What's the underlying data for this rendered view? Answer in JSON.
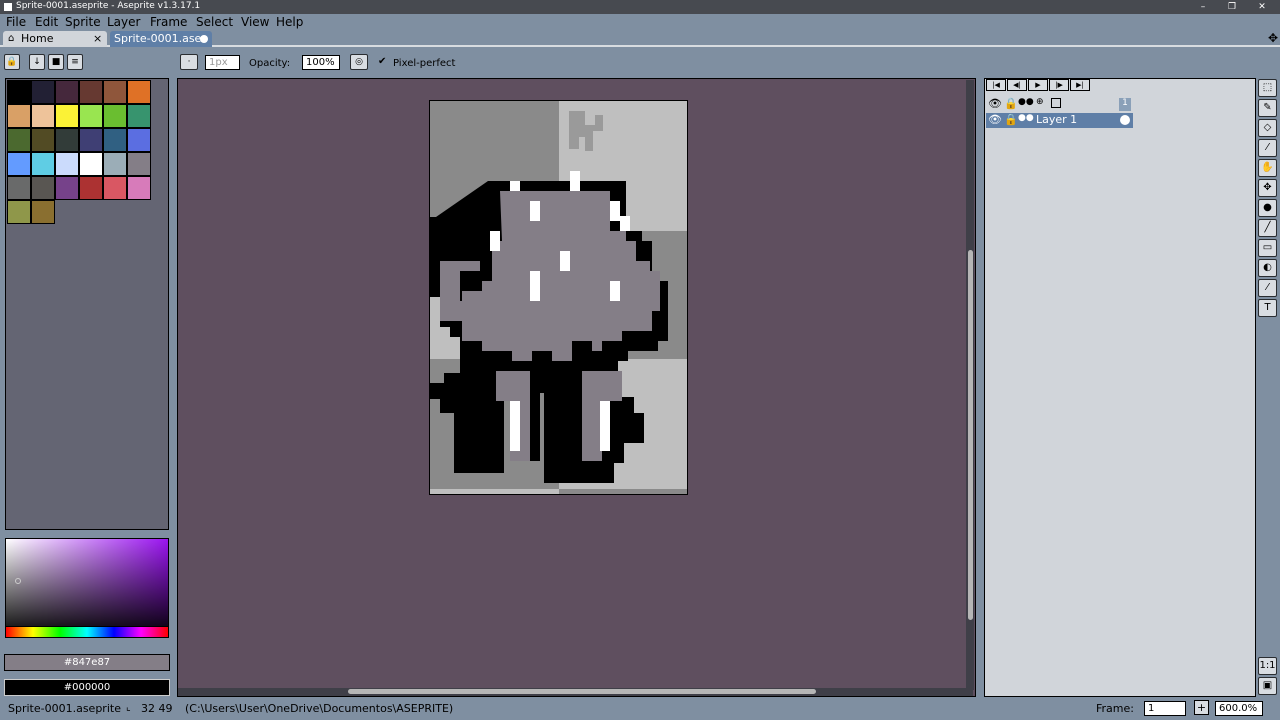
{
  "window": {
    "title": "Sprite-0001.aseprite - Aseprite v1.3.17.1",
    "min": "–",
    "max": "❐",
    "close": "✕"
  },
  "menu": {
    "file": "File",
    "edit": "Edit",
    "sprite": "Sprite",
    "layer": "Layer",
    "frame": "Frame",
    "select": "Select",
    "view": "View",
    "help": "Help"
  },
  "tabs": {
    "home": "Home",
    "home_close": "×",
    "sprite": "Sprite-0001.ase"
  },
  "toolbar": {
    "brush_size": "1px",
    "opacity_label": "Opacity:",
    "opacity_value": "100%",
    "pixel_perfect_label": "Pixel-perfect"
  },
  "palette": {
    "colors": [
      "#000000",
      "#222034",
      "#45283c",
      "#663931",
      "#8f563b",
      "#df7126",
      "#d9a066",
      "#eec39a",
      "#fbf236",
      "#99e550",
      "#6abe30",
      "#37946e",
      "#4b692f",
      "#524b24",
      "#323c39",
      "#3f3f74",
      "#306082",
      "#5b6ee1",
      "#639bff",
      "#5fcde4",
      "#cbdbfc",
      "#ffffff",
      "#9badb7",
      "#847e87",
      "#696a6a",
      "#595652",
      "#76428a",
      "#ac3232",
      "#d95763",
      "#d77bba",
      "#8f974a",
      "#8a6f30"
    ]
  },
  "colors": {
    "fg": "#847e87",
    "bg": "#000000"
  },
  "timeline": {
    "frame_number": "1",
    "layer_name": "Layer 1"
  },
  "status": {
    "filename": "Sprite-0001.aseprite",
    "coords": "32 49",
    "path": "(C:\\Users\\User\\OneDrive\\Documentos\\ASEPRITE)",
    "frame_label": "Frame:",
    "frame_value": "1",
    "zoom": "600.0%"
  }
}
